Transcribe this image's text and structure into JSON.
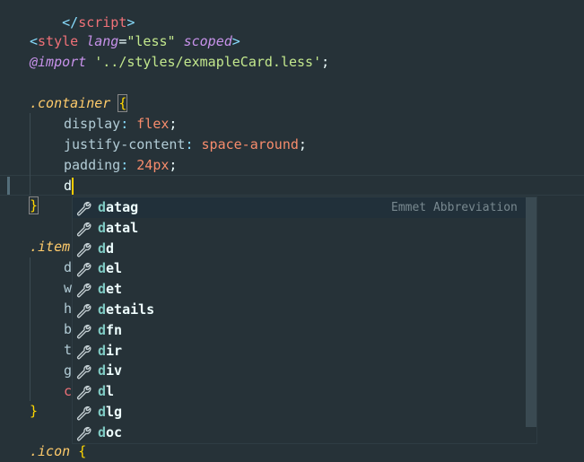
{
  "code": {
    "script_close": {
      "open": "</",
      "name": "script",
      "close": ">"
    },
    "style_open": {
      "open": "<",
      "name": "style",
      "attr1": "lang",
      "eq": "=",
      "val1": "\"less\"",
      "attr2": "scoped",
      "close": ">"
    },
    "import_line": {
      "at": "@import",
      "str": "'../styles/exmapleCard.less'",
      "semi": ";"
    },
    "container_selector": ".container",
    "open_brace": "{",
    "close_brace": "}",
    "decls": [
      {
        "prop": "display",
        "colon": ":",
        "val": "flex",
        "semi": ";"
      },
      {
        "prop": "justify-content",
        "colon": ":",
        "val": "space-around",
        "semi": ";"
      },
      {
        "prop": "padding",
        "colon": ":",
        "val": "24px",
        "semi": ";"
      }
    ],
    "typed": "d",
    "item_selector": ".item",
    "item_hidden_chars": [
      "d",
      "w",
      "h",
      "b",
      "t",
      "g",
      "c"
    ],
    "icon_selector": ".icon",
    "icon_brace": "{"
  },
  "suggestions": {
    "detail": "Emmet Abbreviation",
    "items": [
      {
        "match": "d",
        "rest": "atag"
      },
      {
        "match": "d",
        "rest": "atal"
      },
      {
        "match": "d",
        "rest": "d"
      },
      {
        "match": "d",
        "rest": "el"
      },
      {
        "match": "d",
        "rest": "et"
      },
      {
        "match": "d",
        "rest": "etails"
      },
      {
        "match": "d",
        "rest": "fn"
      },
      {
        "match": "d",
        "rest": "ir"
      },
      {
        "match": "d",
        "rest": "iv"
      },
      {
        "match": "d",
        "rest": "l"
      },
      {
        "match": "d",
        "rest": "lg"
      },
      {
        "match": "d",
        "rest": "oc"
      }
    ]
  },
  "colors": {
    "background": "#263238",
    "match": "#80CBC4",
    "caret": "#FFCC00"
  },
  "icons": {
    "suggestion": "wrench-icon"
  }
}
